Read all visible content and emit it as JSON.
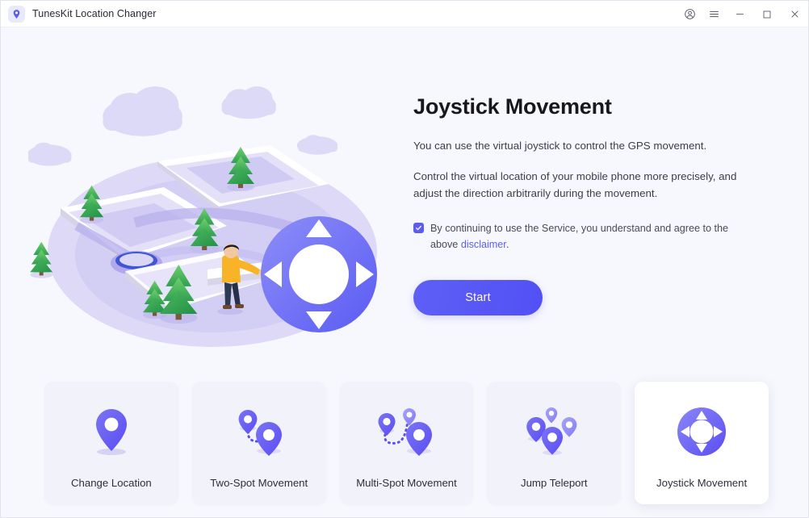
{
  "window": {
    "title": "TunesKit Location Changer",
    "logo_icon": "location-pin-icon",
    "controls": {
      "account": "account-icon",
      "menu": "hamburger-menu-icon",
      "minimize": "minimize-icon",
      "maximize": "maximize-icon",
      "close": "close-icon"
    }
  },
  "hero": {
    "illustration": "isometric-map-with-joystick-illustration",
    "title": "Joystick Movement",
    "paragraph1": "You can use the virtual joystick to control the GPS movement.",
    "paragraph2": "Control the virtual location of your mobile phone more precisely, and adjust the direction arbitrarily during the movement.",
    "agreement": {
      "checked": true,
      "text_before": "By continuing to use the Service, you understand and agree to the above ",
      "link_text": "disclaimer",
      "text_after": "."
    },
    "start_label": "Start"
  },
  "modes": [
    {
      "label": "Change Location",
      "icon": "single-pin-icon",
      "active": false
    },
    {
      "label": "Two-Spot Movement",
      "icon": "two-pin-route-icon",
      "active": false
    },
    {
      "label": "Multi-Spot Movement",
      "icon": "multi-pin-route-icon",
      "active": false
    },
    {
      "label": "Jump Teleport",
      "icon": "scattered-pins-icon",
      "active": false
    },
    {
      "label": "Joystick Movement",
      "icon": "joystick-dpad-icon",
      "active": true
    }
  ],
  "colors": {
    "accent": "#5b5cf0",
    "accent_dark": "#5250f4",
    "page_bg": "#f7f8fd",
    "card_bg": "#f2f2fb",
    "card_active_bg": "#ffffff"
  }
}
